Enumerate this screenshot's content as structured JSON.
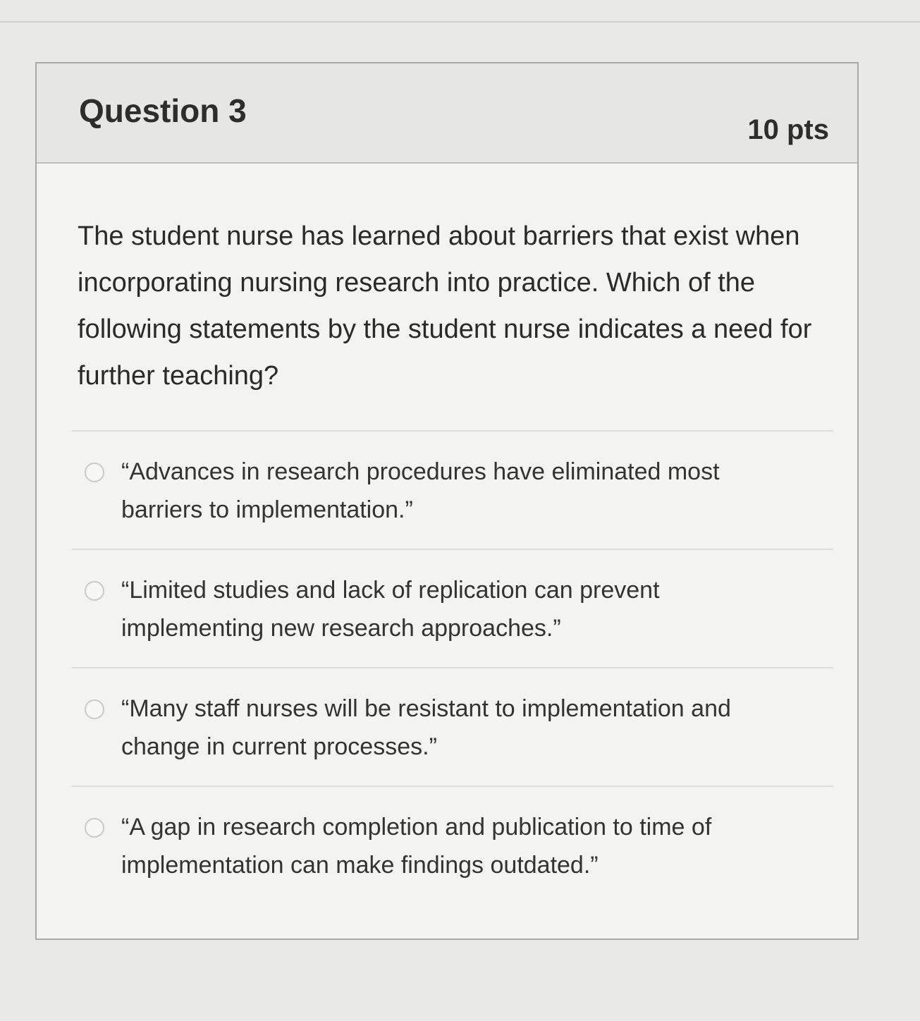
{
  "question": {
    "title": "Question 3",
    "points": "10 pts",
    "text": "The student nurse has learned about barriers that exist when incorporating nursing research into practice. Which of the following statements by the student nurse indicates a need for further teaching?"
  },
  "answers": [
    {
      "label": "“Advances in research procedures have eliminated most barriers to implementation.”"
    },
    {
      "label": "“Limited studies and lack of replication can prevent implementing new research approaches.”"
    },
    {
      "label": "“Many staff nurses will be resistant to implementation and change in current processes.”"
    },
    {
      "label": "“A gap in research completion and publication to time of implementation can make findings outdated.”"
    }
  ]
}
